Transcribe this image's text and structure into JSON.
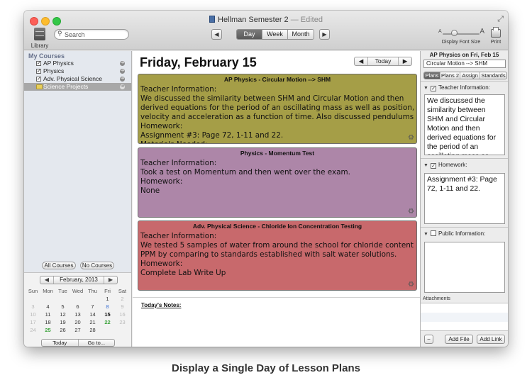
{
  "window": {
    "title": "Hellman Semester 2",
    "title_separator": "—",
    "status": "Edited"
  },
  "toolbar": {
    "library_label": "Library",
    "search_placeholder": "Search",
    "prev_arrow": "◀",
    "next_arrow": "▶",
    "views": [
      {
        "label": "Day",
        "active": true
      },
      {
        "label": "Week",
        "active": false
      },
      {
        "label": "Month",
        "active": false
      }
    ],
    "font_size_label": "Display Font Size",
    "print_label": "Print"
  },
  "sidebar": {
    "section_title": "My Courses",
    "courses": [
      {
        "label": "AP Physics",
        "checked": true,
        "selected": false,
        "icon": "checkbox"
      },
      {
        "label": "Physics",
        "checked": true,
        "selected": false,
        "icon": "checkbox"
      },
      {
        "label": "Adv. Physical Science",
        "checked": true,
        "selected": false,
        "icon": "checkbox"
      },
      {
        "label": "Science Projects",
        "checked": false,
        "selected": true,
        "icon": "folder-icon"
      }
    ],
    "all_courses_label": "All Courses",
    "no_courses_label": "No Courses"
  },
  "calendar": {
    "month_label": "February, 2013",
    "weekdays": [
      "Sun",
      "Mon",
      "Tue",
      "Wed",
      "Thu",
      "Fri",
      "Sat"
    ],
    "weeks": [
      [
        "",
        "",
        "",
        "",
        "",
        "1",
        "2"
      ],
      [
        "3",
        "4",
        "5",
        "6",
        "7",
        "8",
        "9"
      ],
      [
        "10",
        "11",
        "12",
        "13",
        "14",
        "15",
        "16"
      ],
      [
        "17",
        "18",
        "19",
        "20",
        "21",
        "22",
        "23"
      ],
      [
        "24",
        "25",
        "26",
        "27",
        "28",
        "",
        ""
      ]
    ],
    "today_label": "Today",
    "goto_label": "Go to...",
    "highlight_colors": {
      "today": "#111111",
      "green": "#3ca33c",
      "blue": "#3a6fd3",
      "weekend": "#b8b8b8"
    }
  },
  "main": {
    "day_title": "Friday, February 15",
    "today_button": "Today",
    "lessons": [
      {
        "title": "AP Physics - Circular Motion --> SHM",
        "color": "#a59e47",
        "lines": [
          "Teacher Information:",
          "We discussed the similarity between SHM and Circular Motion and then",
          "derived equations for the period of an oscillating mass as well as position,",
          "velocity and acceleration as a function of time.  Also discussed pendulums.",
          "Homework:",
          "Assignment #3: Page 72, 1-11 and 22.",
          "Materials Needed:"
        ]
      },
      {
        "title": "Physics - Momentum Test",
        "color": "#ad86a8",
        "lines": [
          "Teacher Information:",
          "Took a test on Momentum and then went over the exam.",
          "Homework:",
          "None"
        ]
      },
      {
        "title": "Adv. Physical Science - Chloride Ion Concentration Testing",
        "color": "#c8696c",
        "lines": [
          "Teacher Information:",
          "We tested 5 samples of water from around the school for chloride content in",
          "PPM by comparing to standards established with salt water solutions.",
          "Homework:",
          "Complete Lab Write Up"
        ]
      }
    ],
    "notes_label": "Today's Notes:"
  },
  "inspector": {
    "title": "AP Physics on Fri, Feb 15",
    "lesson_select": "Circular Motion --> SHM",
    "tabs": [
      {
        "label": "Plans",
        "active": true
      },
      {
        "label": "Plans 2",
        "active": false
      },
      {
        "label": "Assign",
        "active": false
      },
      {
        "label": "Standards",
        "active": false
      }
    ],
    "sections": [
      {
        "label": "Teacher Information:",
        "checked": true,
        "text": "We discussed the similarity between SHM and Circular Motion and then derived equations for the period of an oscillating mass as well"
      },
      {
        "label": "Homework:",
        "checked": true,
        "text": "Assignment #3: Page 72, 1-11 and 22."
      },
      {
        "label": "Public Information:",
        "checked": false,
        "text": ""
      }
    ],
    "attachments_label": "Attachments",
    "remove_label": "−",
    "add_file_label": "Add File",
    "add_link_label": "Add Link"
  },
  "caption": "Display a Single Day of Lesson Plans"
}
